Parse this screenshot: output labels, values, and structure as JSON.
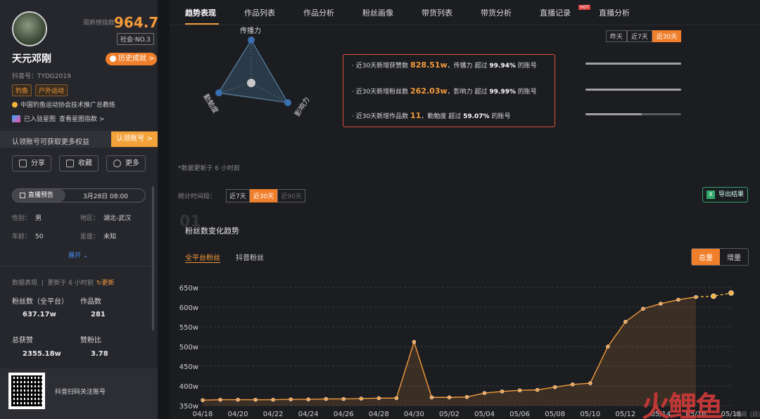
{
  "profile": {
    "score_label": "周新榜指数",
    "score": "964.7",
    "rank": "社会·NO.3",
    "name": "天元邓刚",
    "history_btn": "历史成就 >",
    "douyin_id": "抖音号：TYDG2019",
    "tags": [
      "钓鱼",
      "户外运动"
    ],
    "certification": "中国钓鱼运动协会技术推广总教练",
    "star_joined": "已入驻星图",
    "star_index": "查看星图指数 >",
    "claim_text": "认领账号可获取更多权益",
    "claim_btn": "认领账号 >",
    "actions": {
      "share": "分享",
      "favorite": "收藏",
      "more": "更多"
    },
    "live_label": "直播预告",
    "live_date": "3月28日 08:00",
    "gender_k": "性别：",
    "gender_v": "男",
    "region_k": "地区：",
    "region_v": "湖北-武汉",
    "age_k": "年龄：",
    "age_v": "50",
    "zodiac_k": "星座：",
    "zodiac_v": "未知",
    "expand": "展开 ⌄",
    "perf_label": "数据表现",
    "perf_updated": "更新于 6 小时前",
    "perf_refresh": "↻更新",
    "fans_k": "粉丝数（全平台）",
    "fans_v": "637.17w",
    "works_k": "作品数",
    "works_v": "281",
    "likes_k": "总获赞",
    "likes_v": "2355.18w",
    "ratio_k": "赞粉比",
    "ratio_v": "3.78",
    "qr_text": "抖音扫码关注账号"
  },
  "tabs": [
    "趋势表现",
    "作品列表",
    "作品分析",
    "粉丝画像",
    "带货列表",
    "带货分析",
    "直播记录",
    "直播分析"
  ],
  "hot_badge": "HOT",
  "radar": {
    "top": "传播力",
    "left": "勤勉度",
    "right": "影响力"
  },
  "range_buttons": [
    "昨天",
    "近7天",
    "近30天"
  ],
  "summary": [
    {
      "prefix": "· 近30天新增获赞数 ",
      "value": "828.51w",
      "mid": "，传播力 超过 ",
      "pct": "99.94%",
      "suffix": " 的账号"
    },
    {
      "prefix": "· 近30天新增粉丝数 ",
      "value": "262.03w",
      "mid": "，影响力 超过 ",
      "pct": "99.99%",
      "suffix": " 的账号"
    },
    {
      "prefix": "· 近30天新增作品数 ",
      "value": "11",
      "mid": "，勤勉度 超过 ",
      "pct": "59.07%",
      "suffix": " 的账号"
    }
  ],
  "progress": [
    0.9994,
    0.9999,
    0.5907
  ],
  "updated_note": "*数据更新于 6 小时前",
  "period_label": "统计时间段：",
  "period_buttons": [
    "近7天",
    "近30天",
    "近90天"
  ],
  "export_btn": "导出结果",
  "section_number": "01",
  "section_title": "粉丝数变化趋势",
  "fan_tabs": [
    "全平台粉丝",
    "抖音粉丝"
  ],
  "toggle": [
    "总量",
    "增量"
  ],
  "watermark": "火鲤鱼",
  "colors": {
    "accent": "#f07f2b",
    "line": "#f39a3a",
    "alert": "#e0503a"
  },
  "chart_data": {
    "type": "line",
    "xlabel": "时间（日）",
    "x_ticks": [
      "04/18",
      "04/20",
      "04/22",
      "04/24",
      "04/26",
      "04/28",
      "04/30",
      "05/02",
      "05/04",
      "05/06",
      "05/08",
      "05/10",
      "05/12",
      "05/14",
      "05/16",
      "05/18"
    ],
    "x": [
      "04/18",
      "04/19",
      "04/20",
      "04/21",
      "04/22",
      "04/23",
      "04/24",
      "04/25",
      "04/26",
      "04/27",
      "04/28",
      "04/29",
      "04/30",
      "05/01",
      "05/02",
      "05/03",
      "05/04",
      "05/05",
      "05/06",
      "05/07",
      "05/08",
      "05/09",
      "05/10",
      "05/11",
      "05/12",
      "05/13",
      "05/14",
      "05/15",
      "05/16",
      "05/17",
      "05/18"
    ],
    "values": [
      364,
      365,
      365,
      365,
      365,
      366,
      366,
      367,
      367,
      368,
      369,
      369,
      512,
      371,
      371,
      372,
      382,
      386,
      389,
      390,
      397,
      404,
      407,
      500,
      563,
      596,
      609,
      619,
      626,
      628,
      636
    ],
    "dashed_from_index": 28,
    "y_ticks": [
      "350w",
      "400w",
      "450w",
      "500w",
      "550w",
      "600w",
      "650w"
    ],
    "ylim": [
      350,
      660
    ],
    "grid": true
  }
}
